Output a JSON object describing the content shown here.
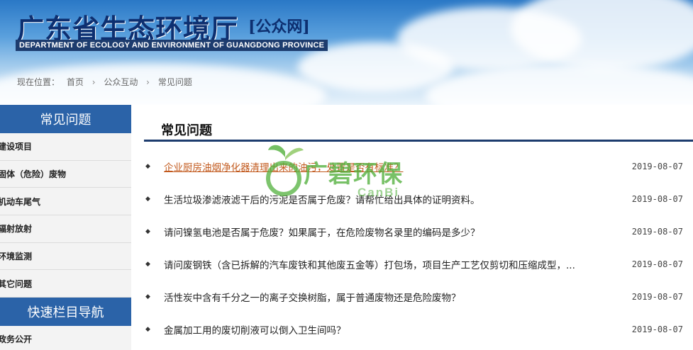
{
  "header": {
    "title": "广东省生态环境厅",
    "subtitle": "[公众网]",
    "english_name": "DEPARTMENT OF ECOLOGY AND ENVIRONMENT OF GUANGDONG PROVINCE"
  },
  "breadcrumb": {
    "label": "现在位置：",
    "items": [
      "首页",
      "公众互动",
      "常见问题"
    ]
  },
  "sidebar": {
    "section1_title": "常见问题",
    "items": [
      "建设项目",
      "固体（危险）废物",
      "机动车尾气",
      "辐射放射",
      "环境监测",
      "其它问题"
    ],
    "section2_title": "快速栏目导航",
    "nav_items": [
      "政务公开"
    ]
  },
  "main": {
    "title": "常见问题",
    "list": [
      {
        "text": "企业厨房油烟净化器清理出来的油污，处置是否有标准？",
        "date": "2019-08-07"
      },
      {
        "text": "生活垃圾渗滤液滤干后的污泥是否属于危废？请帮忙给出具体的证明资料。",
        "date": "2019-08-07"
      },
      {
        "text": "请问镍氢电池是否属于危废？如果属于，在危险废物名录里的编码是多少？",
        "date": "2019-08-07"
      },
      {
        "text": "请问废钢铁（含已拆解的汽车废铁和其他废五金等）打包场，项目生产工艺仅剪切和压缩成型，...",
        "date": "2019-08-07"
      },
      {
        "text": "活性炭中含有千分之一的离子交换树脂，属于普通废物还是危险废物？",
        "date": "2019-08-07"
      },
      {
        "text": "金属加工用的废切削液可以倒入卫生间吗？",
        "date": "2019-08-07"
      }
    ]
  },
  "watermark": {
    "text": "广碧环保",
    "sub": "CanBi"
  },
  "colors": {
    "brand_blue": "#2b63a8",
    "title_navy": "#0d2f70",
    "active_link": "#c25a1e",
    "watermark_green": "#52b03c"
  }
}
